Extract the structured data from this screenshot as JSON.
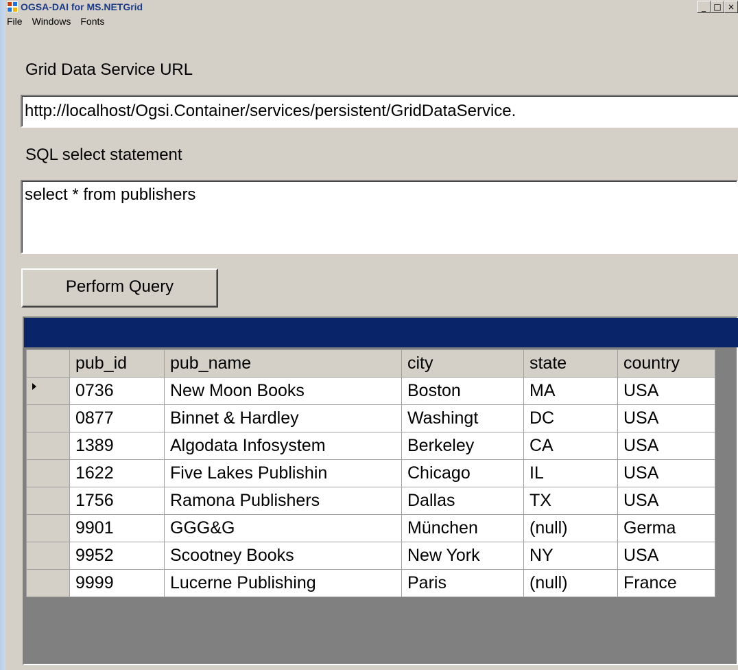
{
  "window": {
    "title": "OGSA-DAI for MS.NETGrid",
    "controls": {
      "minimize": "_",
      "maximize": "□",
      "close": "×"
    }
  },
  "menu": [
    "File",
    "Windows",
    "Fonts"
  ],
  "url_section": {
    "label": "Grid Data Service URL",
    "value": "http://localhost/Ogsi.Container/services/persistent/GridDataService."
  },
  "sql_section": {
    "label": "SQL select statement",
    "value": "select * from publishers"
  },
  "perform_query_button": "Perform Query",
  "results": {
    "columns": [
      "pub_id",
      "pub_name",
      "city",
      "state",
      "country"
    ],
    "rows": [
      [
        "0736",
        "New Moon Books",
        "Boston",
        "MA",
        "USA"
      ],
      [
        "0877",
        "Binnet & Hardley",
        "Washingt",
        "DC",
        "USA"
      ],
      [
        "1389",
        "Algodata Infosystem",
        "Berkeley",
        "CA",
        "USA"
      ],
      [
        "1622",
        "Five Lakes Publishin",
        "Chicago",
        "IL",
        "USA"
      ],
      [
        "1756",
        "Ramona Publishers",
        "Dallas",
        "TX",
        "USA"
      ],
      [
        "9901",
        "GGG&G",
        "München",
        "(null)",
        "Germa"
      ],
      [
        "9952",
        "Scootney Books",
        "New York",
        "NY",
        "USA"
      ],
      [
        "9999",
        "Lucerne Publishing",
        "Paris",
        "(null)",
        "France"
      ]
    ],
    "current_row": 0
  },
  "colors": {
    "window_bg": "#d4d0c8",
    "grid_caption": "#0a246a",
    "grid_bg": "#808080"
  }
}
